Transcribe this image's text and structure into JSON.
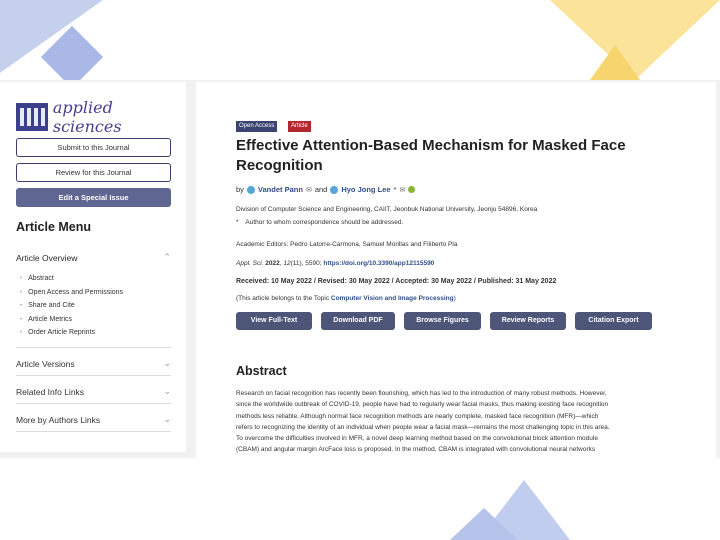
{
  "colors": {
    "brand": "#3c3f8a",
    "accent_button": "#5f6691",
    "link": "#2f4f8a",
    "open_access": "#3b4470",
    "article_badge": "#b3272f",
    "action_button": "#4d5578"
  },
  "sidebar": {
    "journal_name": "applied sciences",
    "logo_icon": "journal-logo-icon",
    "buttons": {
      "submit": "Submit to this Journal",
      "review": "Review for this Journal",
      "special_issue": "Edit a Special Issue"
    },
    "menu_title": "Article Menu",
    "overview": {
      "label": "Article Overview",
      "items": [
        "Abstract",
        "Open Access and Permissions",
        "Share and Cite",
        "Article Metrics",
        "Order Article Reprints"
      ]
    },
    "sections": [
      "Article Versions",
      "Related Info Links",
      "More by Authors Links"
    ]
  },
  "article": {
    "badges": {
      "open_access": "Open Access",
      "type": "Article"
    },
    "title_line1": "Effective Attention-Based Mechanism for Masked Face",
    "title_line2": "Recognition",
    "by": "by",
    "author1": "Vandet Pann",
    "and": "and",
    "author2": "Hyo Jong Lee",
    "author2_mark": "*",
    "affiliation": "Division of Computer Science and Engineering, CAIIT, Jeonbuk National University, Jeonju 54896, Korea",
    "corresponding_mark": "*",
    "corresponding": "Author to whom correspondence should be addressed.",
    "editors": "Academic Editors: Pedro Latorre-Carmona, Samuel Morillas and Filiberto Pla",
    "citation_journal": "Appl. Sci.",
    "citation_year": "2022",
    "citation_volume": "12",
    "citation_rest": "(11), 5590;",
    "doi": "https://doi.org/10.3390/app12115590",
    "dates": "Received: 10 May 2022 / Revised: 30 May 2022 / Accepted: 30 May 2022 / Published: 31 May 2022",
    "topic_prefix": "(This article belongs to the Topic",
    "topic": "Computer Vision and Image Processing",
    "topic_suffix": ")",
    "actions": [
      "View Full-Text",
      "Download PDF",
      "Browse Figures",
      "Review Reports",
      "Citation Export"
    ],
    "abstract_heading": "Abstract",
    "abstract_lines": [
      "Research on facial recognition has recently been flourishing, which has led to the introduction of many robust methods. However,",
      "since the worldwide outbreak of COVID-19, people have had to regularly wear facial masks, thus making existing face recognition",
      "methods less reliable. Although normal face recognition methods are nearly complete, masked face recognition (MFR)—which",
      "refers to recognizing the identity of an individual when people wear a facial mask—remains the most challenging topic in this area.",
      "To overcome the difficulties involved in MFR, a novel deep learning method based on the convolutional block attention module",
      "(CBAM) and angular margin ArcFace loss is proposed. In the method, CBAM is integrated with convolutional neural networks"
    ]
  }
}
